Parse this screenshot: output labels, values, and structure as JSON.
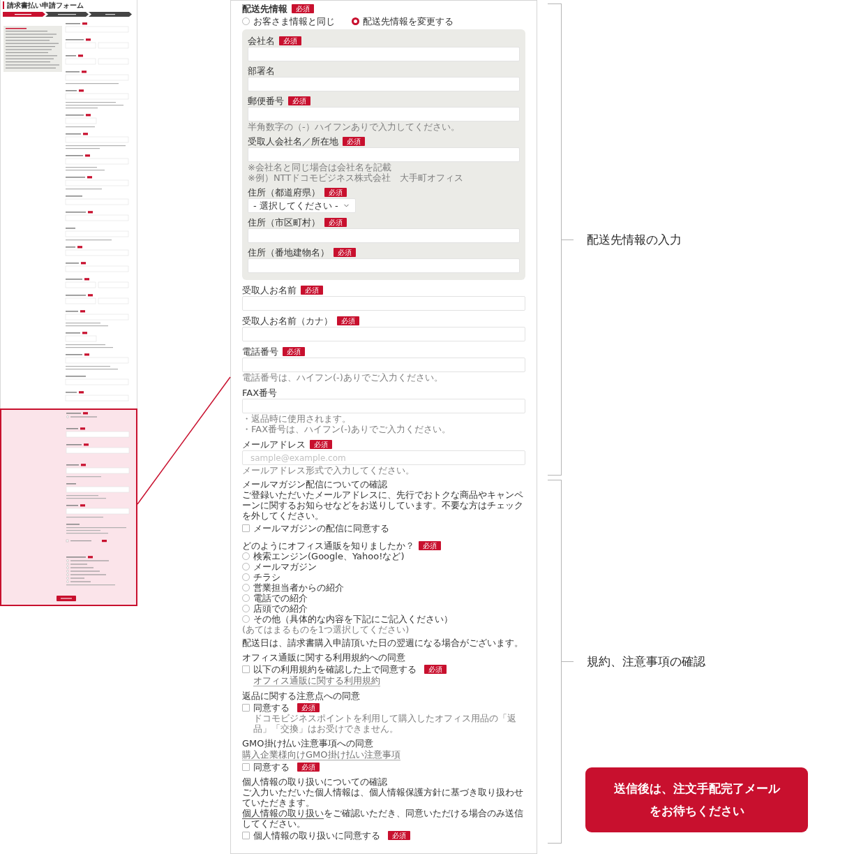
{
  "thumbnail": {
    "title": "請求書払い申請フォーム"
  },
  "shipping": {
    "label": "配送先情報",
    "badge": "必須",
    "options": [
      {
        "label": "お客さま情報と同じ",
        "selected": false
      },
      {
        "label": "配送先情報を変更する",
        "selected": true
      }
    ],
    "address_fields": [
      {
        "kind": "text",
        "label": "会社名",
        "badge": "必須"
      },
      {
        "kind": "text",
        "label": "部署名"
      },
      {
        "kind": "text",
        "label": "郵便番号",
        "badge": "必須",
        "hints": [
          "半角数字の（-）ハイフンありで入力してください。"
        ]
      },
      {
        "kind": "text",
        "label": "受取人会社名／所在地",
        "badge": "必須",
        "hints": [
          "※会社名と同じ場合は会社名を記載",
          "※例）NTTドコモビジネス株式会社　大手町オフィス"
        ]
      },
      {
        "kind": "select",
        "label": "住所（都道府県）",
        "badge": "必須",
        "value": "- 選択してください -"
      },
      {
        "kind": "text",
        "label": "住所（市区町村）",
        "badge": "必須"
      },
      {
        "kind": "text",
        "label": "住所（番地建物名）",
        "badge": "必須"
      }
    ]
  },
  "recipient_fields": [
    {
      "kind": "text",
      "label": "受取人お名前",
      "badge": "必須"
    },
    {
      "kind": "text",
      "label": "受取人お名前（カナ）",
      "badge": "必須"
    },
    {
      "kind": "text",
      "label": "電話番号",
      "badge": "必須",
      "hints": [
        "電話番号は、ハイフン(-)ありでご入力ください。"
      ]
    },
    {
      "kind": "text",
      "label": "FAX番号",
      "hints": [
        "・返品時に使用されます。",
        "・FAX番号は、ハイフン(-)ありでご入力ください。"
      ]
    },
    {
      "kind": "text",
      "label": "メールアドレス",
      "badge": "必須",
      "placeholder": "sample@example.com",
      "hints": [
        "メールアドレス形式で入力してください。"
      ]
    }
  ],
  "newsletter": {
    "title": "メールマガジン配信についての確認",
    "text": "ご登録いただいたメールアドレスに、先行でおトクな商品やキャンペーンに関するお知らせなどをお送りしています。不要な方はチェックを外してください。",
    "checkbox": {
      "label": "メールマガジンの配信に同意する",
      "checked": false
    }
  },
  "survey": {
    "question": "どのようにオフィス通販を知りましたか？",
    "badge": "必須",
    "options": [
      {
        "label": "検索エンジン(Google、Yahoo!など)",
        "selected": false
      },
      {
        "label": "メールマガジン",
        "selected": false
      },
      {
        "label": "チラシ",
        "selected": false
      },
      {
        "label": "営業担当者からの紹介",
        "selected": false
      },
      {
        "label": "電話での紹介",
        "selected": false
      },
      {
        "label": "店頭での紹介",
        "selected": false
      },
      {
        "label": "その他（具体的な内容を下記にご記入ください）",
        "selected": false
      }
    ],
    "hint": "(あてはまるものを1つ選択してください)"
  },
  "delivery_note": "配送日は、請求書購入申請頂いた日の翌週になる場合がございます。",
  "agreements": [
    {
      "title": "オフィス通販に関する利用規約への同意",
      "parts": [
        {
          "kind": "checkbox",
          "label": "以下の利用規約を確認した上で同意する",
          "badge": "必須",
          "checked": false
        },
        {
          "kind": "link",
          "text": "オフィス通販に関する利用規約"
        }
      ]
    },
    {
      "title": "返品に関する注意点への同意",
      "parts": [
        {
          "kind": "checkbox",
          "label": "同意する",
          "badge": "必須",
          "checked": false
        },
        {
          "kind": "note",
          "text": "ドコモビジネスポイントを利用して購入したオフィス用品の「返品」「交換」はお受けできません。"
        }
      ]
    },
    {
      "title": "GMO掛け払い注意事項への同意",
      "parts": [
        {
          "kind": "link",
          "text": "購入企業様向けGMO掛け払い注意事項"
        },
        {
          "kind": "checkbox",
          "label": "同意する",
          "badge": "必須",
          "checked": false
        }
      ]
    },
    {
      "title": "個人情報の取り扱いについての確認",
      "parts": [
        {
          "kind": "text",
          "text": "ご入力いただいた個人情報は、個人情報保護方針に基づき取り扱わせていただきます。"
        },
        {
          "kind": "text",
          "link": "個人情報の取り扱い",
          "text": "をご確認いただき、同意いただける場合のみ送信してください。"
        },
        {
          "kind": "checkbox",
          "label": "個人情報の取り扱いに同意する",
          "badge": "必須",
          "checked": false
        }
      ]
    }
  ],
  "annotations": {
    "sections": [
      {
        "label": "配送先情報の入力"
      },
      {
        "label": "規約、注意事項の確認"
      }
    ],
    "notice": [
      "送信後は、注文手配完了メール",
      "をお待ちください"
    ]
  }
}
